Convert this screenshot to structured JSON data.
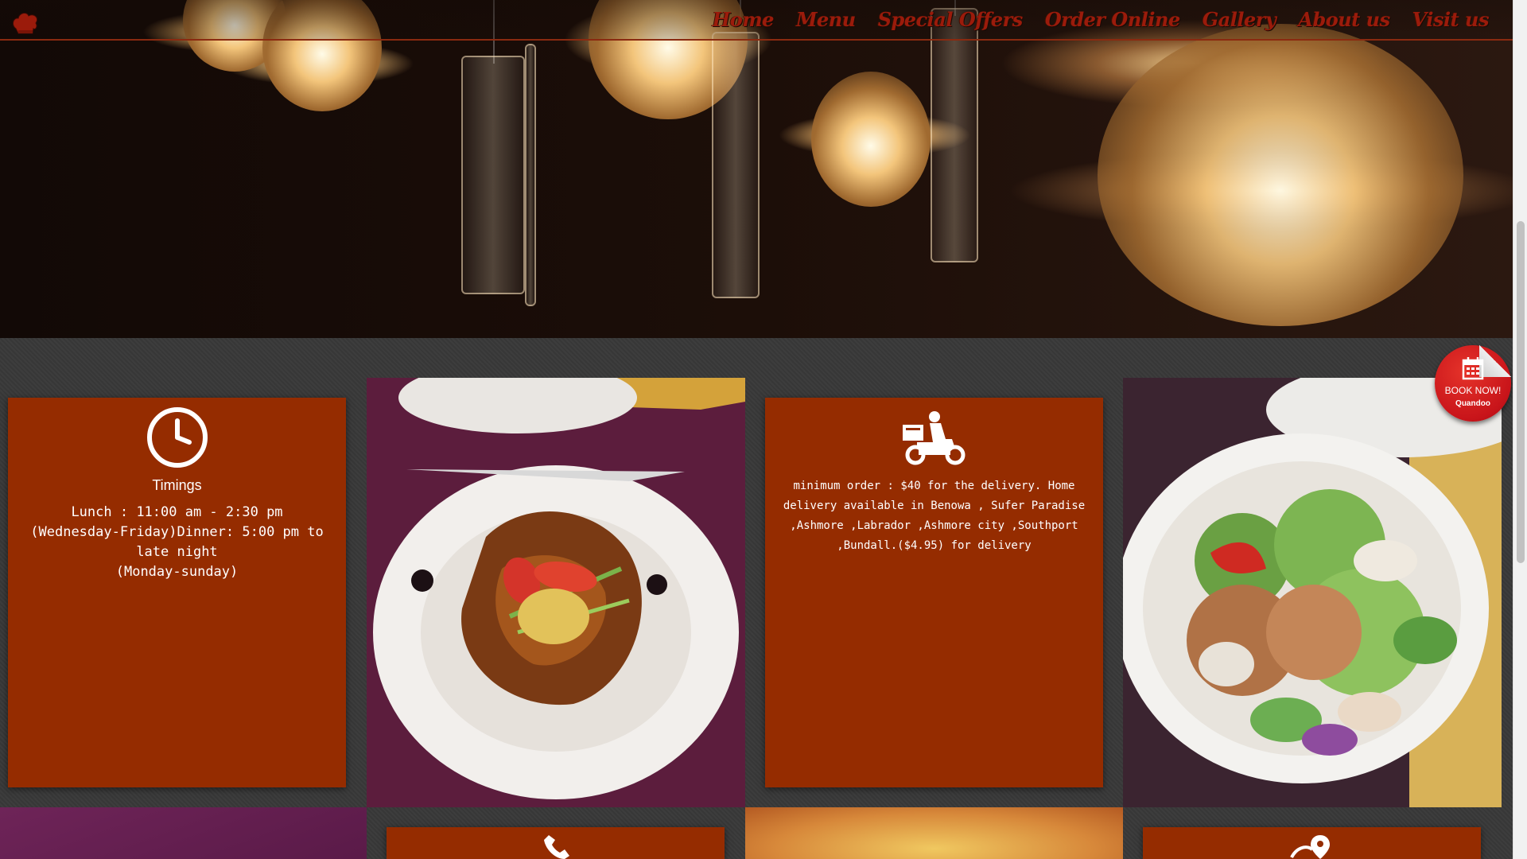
{
  "nav": {
    "logo": "chef-hat-logo",
    "links": [
      "Home",
      "Menu",
      "Special Offers",
      "Order Online",
      "Gallery",
      "About us",
      "Visit us"
    ]
  },
  "timings_card": {
    "icon": "clock-icon",
    "title": "Timings",
    "lines": [
      "Lunch : 11:00 am - 2:30 pm",
      "(Wednesday-Friday)Dinner: 5:00 pm to late night",
      "(Monday-sunday)"
    ]
  },
  "delivery_card": {
    "icon": "delivery-scooter-icon",
    "text": "minimum order : $40 for the delivery. Home delivery available in Benowa , Sufer Paradise ,Ashmore ,Labrador ,Ashmore city ,Southport ,Bundall.($4.95) for delivery"
  },
  "book_now": {
    "label": "BOOK NOW!",
    "brand": "Quandoo",
    "icon": "calendar-icon"
  },
  "lower_cards": {
    "left_icon": "phone-icon",
    "right_icon": "map-pin-icon"
  },
  "colors": {
    "card": "#952c00",
    "nav_link": "#9b1b0b",
    "background": "#3a3a3a",
    "badge": "#c8141a"
  }
}
